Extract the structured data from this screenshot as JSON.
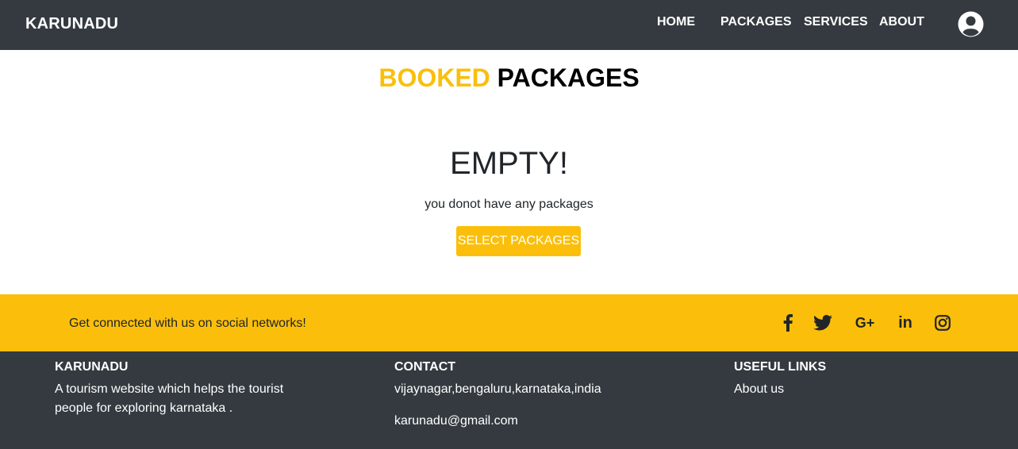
{
  "navbar": {
    "brand": "KARUNADU",
    "links": [
      "HOME",
      "PACKAGES",
      "SERVICES",
      "ABOUT"
    ],
    "avatar_icon": "user-circle-icon"
  },
  "main": {
    "title_accent": "BOOKED",
    "title_rest": "PACKAGES",
    "empty_heading": "EMPTY!",
    "empty_text": "you donot have any packages",
    "select_button": "SELECT PACKAGES"
  },
  "social_bar": {
    "text": "Get connected with us on social networks!",
    "icons": [
      "facebook-icon",
      "twitter-icon",
      "google-plus-icon",
      "linkedin-icon",
      "instagram-icon"
    ],
    "google_glyph": "G+",
    "linkedin_glyph": "in"
  },
  "footer": {
    "brand": {
      "heading": "KARUNADU",
      "description": "A tourism website which helps the tourist people for exploring karnataka ."
    },
    "contact": {
      "heading": "CONTACT",
      "address": "vijaynagar,bengaluru,karnataka,india",
      "email": "karunadu@gmail.com"
    },
    "useful_links": {
      "heading": "USEFUL LINKS",
      "link": "About us"
    }
  },
  "colors": {
    "nav_bg": "#343a40",
    "accent": "#fbbf0b",
    "text": "#212529"
  }
}
